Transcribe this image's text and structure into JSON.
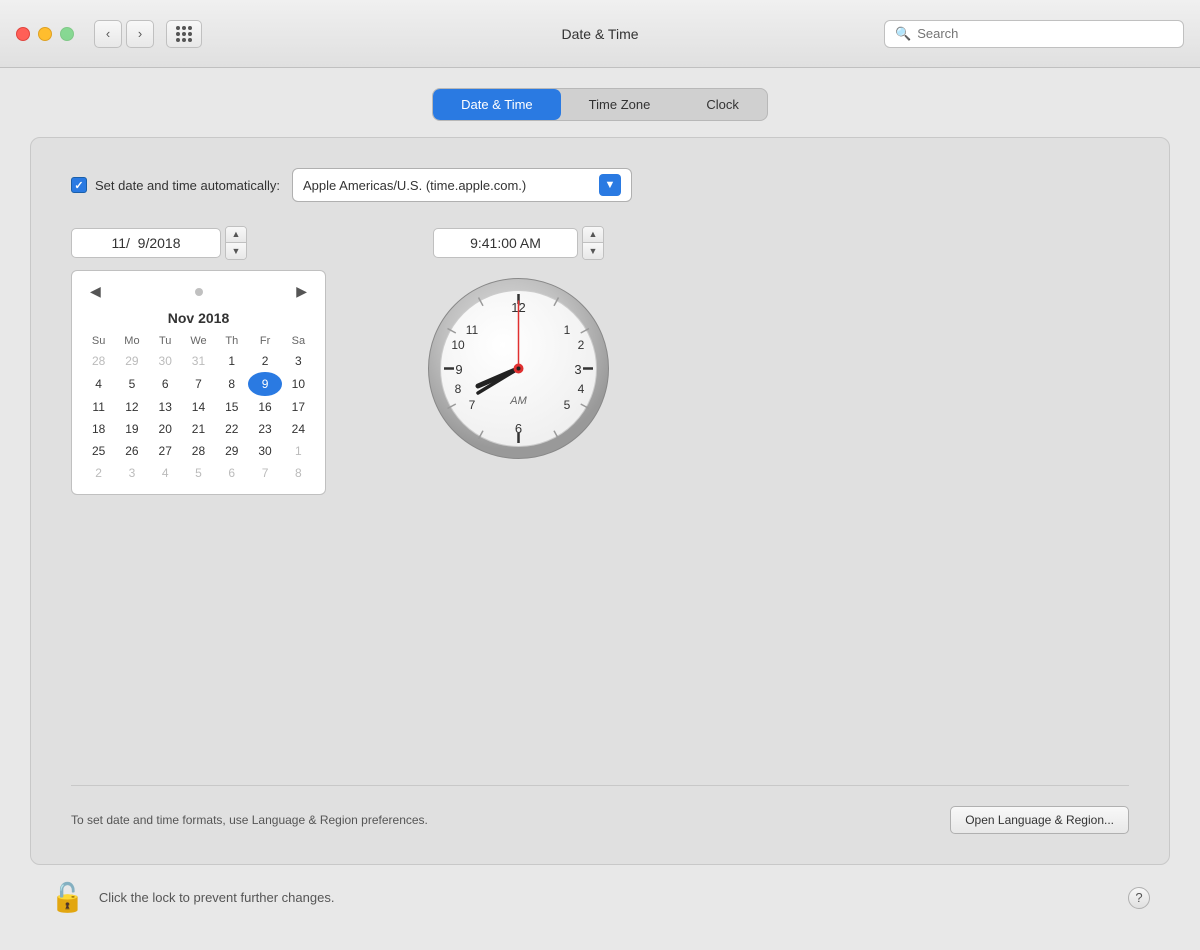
{
  "window": {
    "title": "Date & Time"
  },
  "titlebar": {
    "back_label": "‹",
    "forward_label": "›"
  },
  "search": {
    "placeholder": "Search"
  },
  "tabs": [
    {
      "id": "date-time",
      "label": "Date & Time",
      "active": true
    },
    {
      "id": "time-zone",
      "label": "Time Zone",
      "active": false
    },
    {
      "id": "clock",
      "label": "Clock",
      "active": false
    }
  ],
  "auto_set": {
    "label": "Set date and time automatically:",
    "checked": true,
    "server": "Apple Americas/U.S. (time.apple.com.)"
  },
  "date_field": {
    "value": "11/  9/2018"
  },
  "time_field": {
    "value": "9:41:00 AM"
  },
  "calendar": {
    "month_year": "Nov 2018",
    "day_headers": [
      "Su",
      "Mo",
      "Tu",
      "We",
      "Th",
      "Fr",
      "Sa"
    ],
    "weeks": [
      [
        {
          "day": "28",
          "outside": true
        },
        {
          "day": "29",
          "outside": true
        },
        {
          "day": "30",
          "outside": true
        },
        {
          "day": "31",
          "outside": true
        },
        {
          "day": "1",
          "outside": false
        },
        {
          "day": "2",
          "outside": false
        },
        {
          "day": "3",
          "outside": false
        }
      ],
      [
        {
          "day": "4",
          "outside": false
        },
        {
          "day": "5",
          "outside": false
        },
        {
          "day": "6",
          "outside": false
        },
        {
          "day": "7",
          "outside": false
        },
        {
          "day": "8",
          "outside": false
        },
        {
          "day": "9",
          "outside": false,
          "selected": true
        },
        {
          "day": "10",
          "outside": false
        }
      ],
      [
        {
          "day": "11",
          "outside": false
        },
        {
          "day": "12",
          "outside": false
        },
        {
          "day": "13",
          "outside": false
        },
        {
          "day": "14",
          "outside": false
        },
        {
          "day": "15",
          "outside": false
        },
        {
          "day": "16",
          "outside": false
        },
        {
          "day": "17",
          "outside": false
        }
      ],
      [
        {
          "day": "18",
          "outside": false
        },
        {
          "day": "19",
          "outside": false
        },
        {
          "day": "20",
          "outside": false
        },
        {
          "day": "21",
          "outside": false
        },
        {
          "day": "22",
          "outside": false
        },
        {
          "day": "23",
          "outside": false
        },
        {
          "day": "24",
          "outside": false
        }
      ],
      [
        {
          "day": "25",
          "outside": false
        },
        {
          "day": "26",
          "outside": false
        },
        {
          "day": "27",
          "outside": false
        },
        {
          "day": "28",
          "outside": false
        },
        {
          "day": "29",
          "outside": false
        },
        {
          "day": "30",
          "outside": false
        },
        {
          "day": "1",
          "outside": true
        }
      ],
      [
        {
          "day": "2",
          "outside": true
        },
        {
          "day": "3",
          "outside": true
        },
        {
          "day": "4",
          "outside": true
        },
        {
          "day": "5",
          "outside": true
        },
        {
          "day": "6",
          "outside": true
        },
        {
          "day": "7",
          "outside": true
        },
        {
          "day": "8",
          "outside": true
        }
      ]
    ]
  },
  "clock": {
    "am_label": "AM",
    "hour": 9,
    "minute": 41,
    "second": 0
  },
  "bottom": {
    "info_text": "To set date and time formats, use Language & Region preferences.",
    "open_btn": "Open Language & Region..."
  },
  "footer": {
    "lock_text": "Click the lock to prevent further changes.",
    "help_label": "?"
  }
}
